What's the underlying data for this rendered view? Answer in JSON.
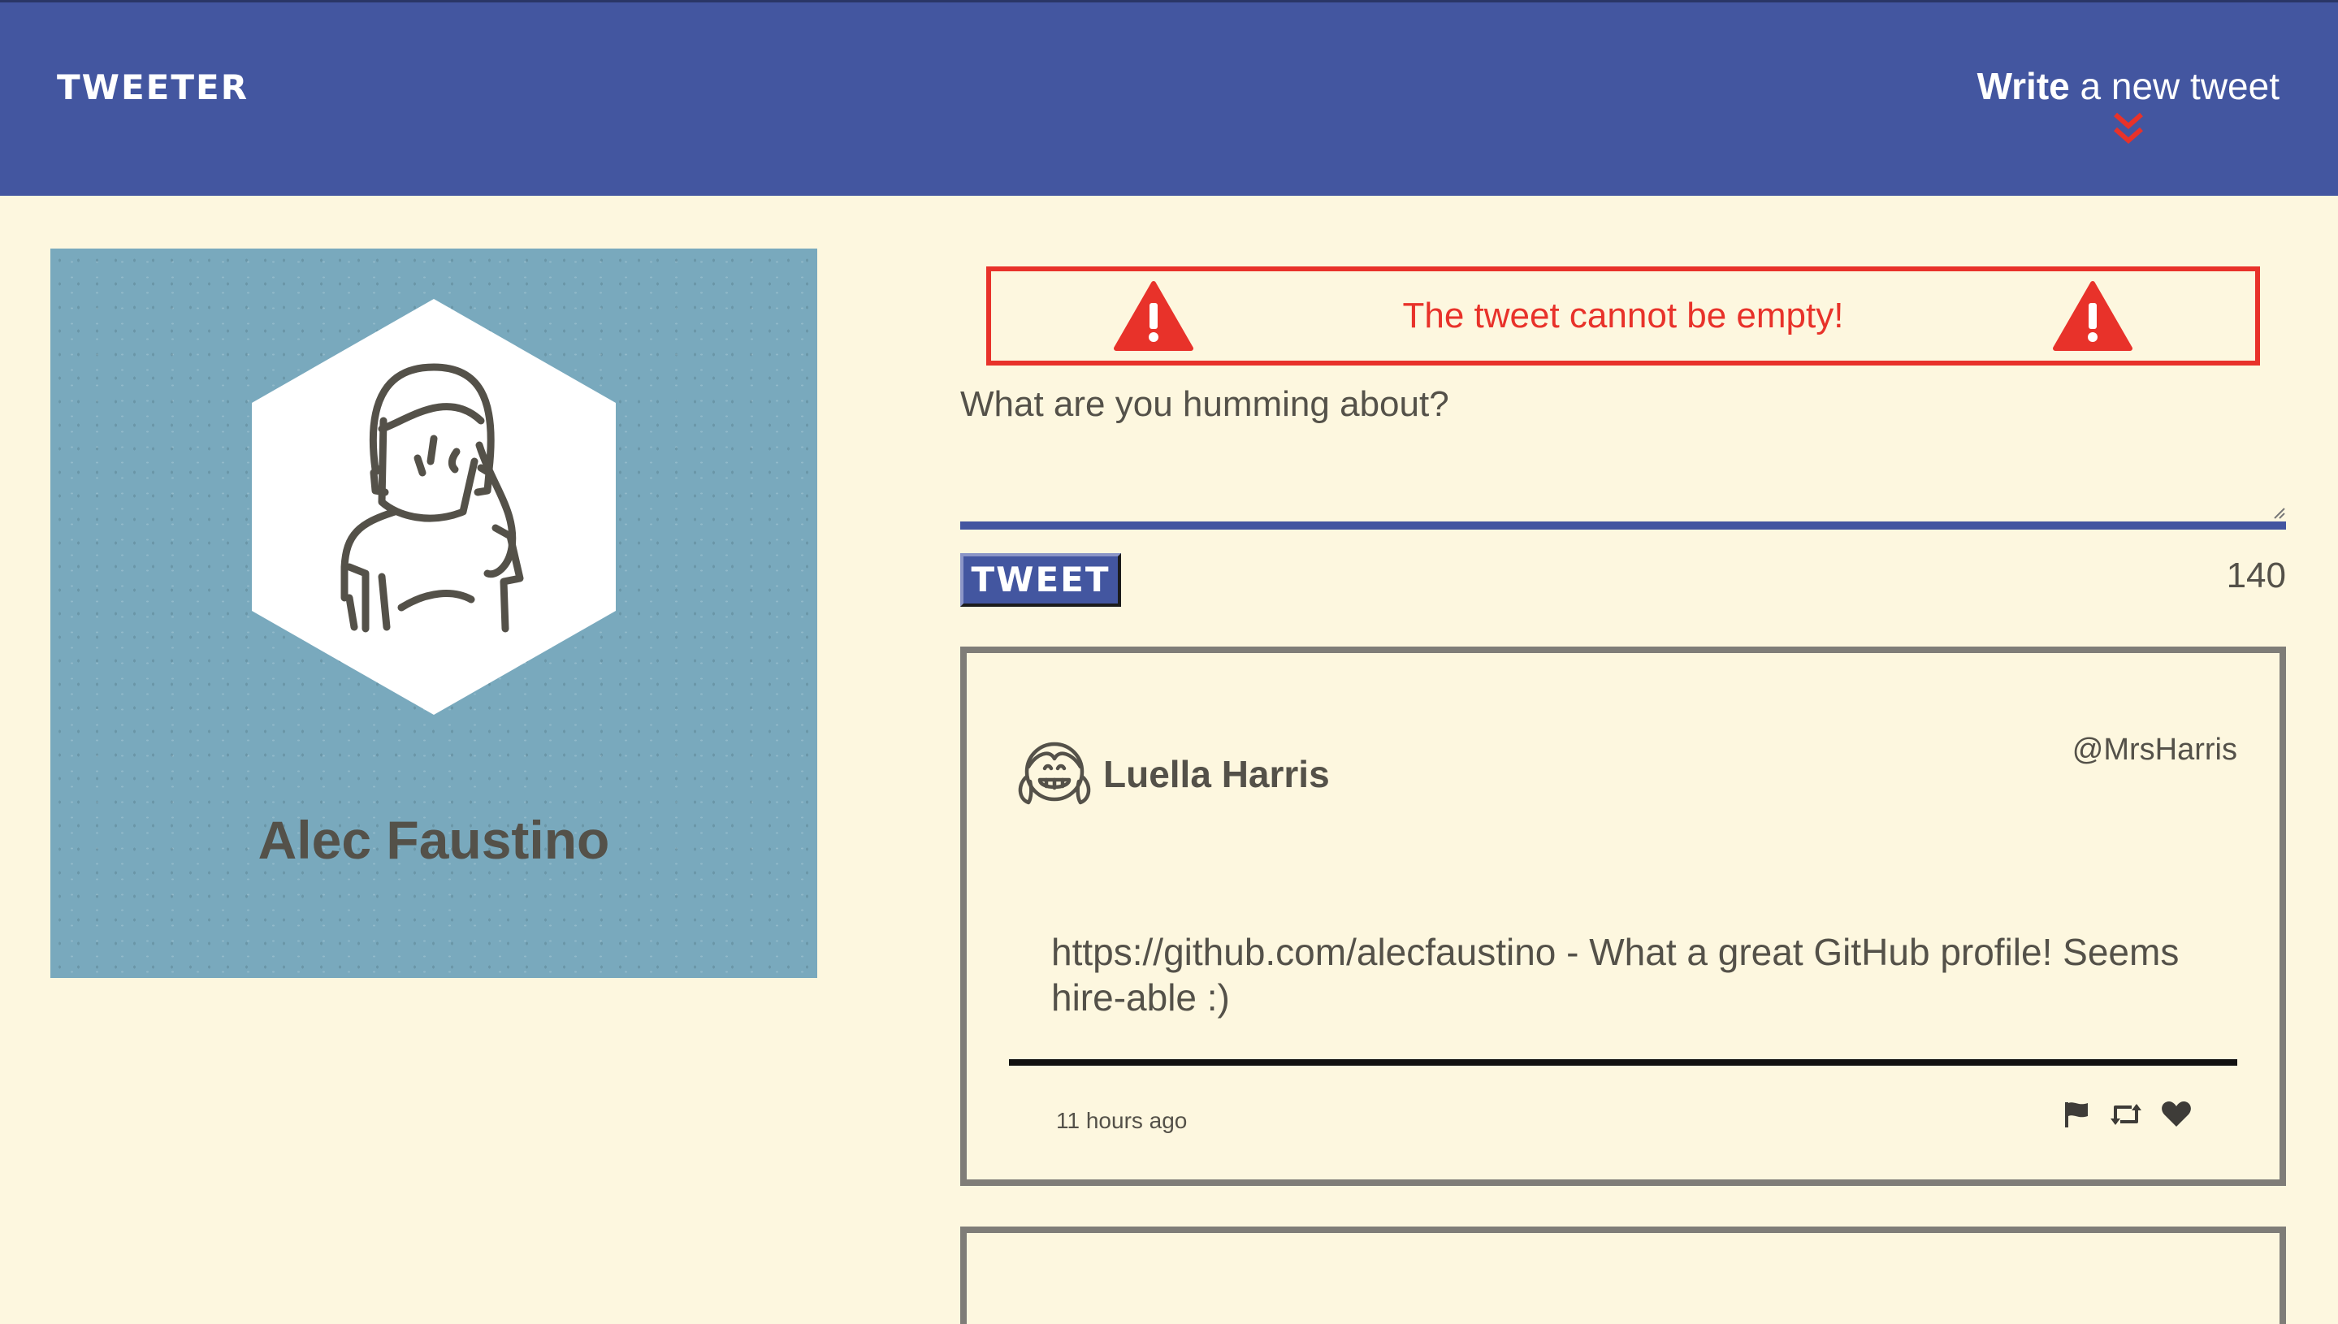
{
  "nav": {
    "brand": "TWEETER",
    "compose_bold": "Write",
    "compose_rest": " a new tweet"
  },
  "profile": {
    "name": "Alec Faustino"
  },
  "composer": {
    "error_message": "The tweet cannot be empty!",
    "prompt_label": "What are you humming about?",
    "textarea_value": "",
    "submit_label": "TWEET",
    "char_counter": "140"
  },
  "tweets": [
    {
      "name": "Luella Harris",
      "handle": "@MrsHarris",
      "content": "https://github.com/alecfaustino - What a great GitHub profile! Seems hire-able :)",
      "time_ago": "11 hours ago",
      "actions": [
        "flag-icon",
        "retweet-icon",
        "heart-icon"
      ]
    }
  ],
  "colors": {
    "nav_bg": "#4356A0",
    "page_bg": "#FDF7DF",
    "error": "#E8322A",
    "profile_bg": "#79A9BD",
    "text": "#545149"
  }
}
